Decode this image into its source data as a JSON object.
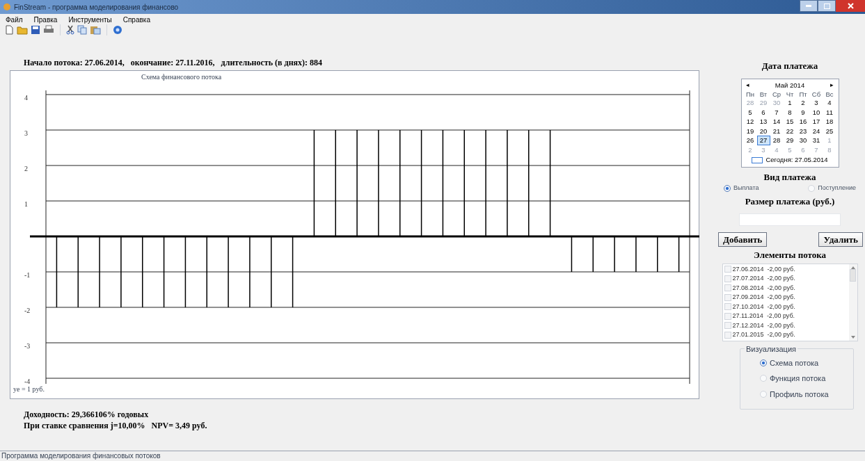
{
  "window": {
    "title": "FinStream - программа моделирования финансово"
  },
  "menu": [
    "Файл",
    "Правка",
    "Инструменты",
    "Справка"
  ],
  "toolbar": [
    {
      "kind": "new"
    },
    {
      "kind": "open"
    },
    {
      "kind": "save"
    },
    {
      "kind": "print"
    },
    {
      "kind": "sep"
    },
    {
      "kind": "cut"
    },
    {
      "kind": "copy"
    },
    {
      "kind": "paste"
    },
    {
      "kind": "sep"
    },
    {
      "kind": "help"
    }
  ],
  "summary": "Начало потока: 27.06.2014,   окончание: 27.11.2016,   длительность (в днях): 884",
  "chart": {
    "unit_label": "ye = 1 руб.",
    "chart_data": {
      "type": "bar",
      "grid": true,
      "title": "Схема финансового потока",
      "yticks": [
        -4,
        -3,
        -2,
        -1,
        1,
        2,
        3,
        4
      ],
      "ylim": [
        -4,
        4
      ],
      "values": [
        -2,
        -2,
        -2,
        -2,
        -2,
        -2,
        -2,
        -2,
        -2,
        -2,
        -2,
        -2,
        3,
        3,
        3,
        3,
        3,
        3,
        3,
        3,
        3,
        3,
        3,
        3,
        -1,
        -1,
        -1,
        -1,
        -1,
        -1
      ]
    }
  },
  "results": [
    "Доходность: 29,366106% годовых",
    "При ставке сравнения j=10,00%   NPV= 3,49 руб."
  ],
  "side": {
    "date_title": "Дата платежа",
    "calendar": {
      "month": "Май 2014",
      "prev": "◂",
      "next": "▸",
      "weekdays": [
        "Пн",
        "Вт",
        "Ср",
        "Чт",
        "Пт",
        "Сб",
        "Вс"
      ],
      "days": [
        {
          "day": "28",
          "other_month": true,
          "selected": false
        },
        {
          "day": "29",
          "other_month": true,
          "selected": false
        },
        {
          "day": "30",
          "other_month": true,
          "selected": false
        },
        {
          "day": "1",
          "other_month": false,
          "selected": false
        },
        {
          "day": "2",
          "other_month": false,
          "selected": false
        },
        {
          "day": "3",
          "other_month": false,
          "selected": false
        },
        {
          "day": "4",
          "other_month": false,
          "selected": false
        },
        {
          "day": "5",
          "other_month": false,
          "selected": false
        },
        {
          "day": "6",
          "other_month": false,
          "selected": false
        },
        {
          "day": "7",
          "other_month": false,
          "selected": false
        },
        {
          "day": "8",
          "other_month": false,
          "selected": false
        },
        {
          "day": "9",
          "other_month": false,
          "selected": false
        },
        {
          "day": "10",
          "other_month": false,
          "selected": false
        },
        {
          "day": "11",
          "other_month": false,
          "selected": false
        },
        {
          "day": "12",
          "other_month": false,
          "selected": false
        },
        {
          "day": "13",
          "other_month": false,
          "selected": false
        },
        {
          "day": "14",
          "other_month": false,
          "selected": false
        },
        {
          "day": "15",
          "other_month": false,
          "selected": false
        },
        {
          "day": "16",
          "other_month": false,
          "selected": false
        },
        {
          "day": "17",
          "other_month": false,
          "selected": false
        },
        {
          "day": "18",
          "other_month": false,
          "selected": false
        },
        {
          "day": "19",
          "other_month": false,
          "selected": false
        },
        {
          "day": "20",
          "other_month": false,
          "selected": false
        },
        {
          "day": "21",
          "other_month": false,
          "selected": false
        },
        {
          "day": "22",
          "other_month": false,
          "selected": false
        },
        {
          "day": "23",
          "other_month": false,
          "selected": false
        },
        {
          "day": "24",
          "other_month": false,
          "selected": false
        },
        {
          "day": "25",
          "other_month": false,
          "selected": false
        },
        {
          "day": "26",
          "other_month": false,
          "selected": false
        },
        {
          "day": "27",
          "other_month": false,
          "selected": true
        },
        {
          "day": "28",
          "other_month": false,
          "selected": false
        },
        {
          "day": "29",
          "other_month": false,
          "selected": false
        },
        {
          "day": "30",
          "other_month": false,
          "selected": false
        },
        {
          "day": "31",
          "other_month": false,
          "selected": false
        },
        {
          "day": "1",
          "other_month": true,
          "selected": false
        },
        {
          "day": "2",
          "other_month": true,
          "selected": false
        },
        {
          "day": "3",
          "other_month": true,
          "selected": false
        },
        {
          "day": "4",
          "other_month": true,
          "selected": false
        },
        {
          "day": "5",
          "other_month": true,
          "selected": false
        },
        {
          "day": "6",
          "other_month": true,
          "selected": false
        },
        {
          "day": "7",
          "other_month": true,
          "selected": false
        },
        {
          "day": "8",
          "other_month": true,
          "selected": false
        }
      ],
      "today": "Сегодня: 27.05.2014"
    },
    "type_title": "Вид платежа",
    "types": [
      {
        "label": "Выплата",
        "selected": true
      },
      {
        "label": "Поступление",
        "selected": false
      }
    ],
    "amount_title": "Размер платежа (руб.)",
    "buttons": [
      "Добавить",
      "Удалить"
    ],
    "elements_title": "Элементы потока",
    "elements": [
      {
        "label": "27.06.2014  -2,00 руб.",
        "checked": false
      },
      {
        "label": "27.07.2014  -2,00 руб.",
        "checked": false
      },
      {
        "label": "27.08.2014  -2,00 руб.",
        "checked": false
      },
      {
        "label": "27.09.2014  -2,00 руб.",
        "checked": false
      },
      {
        "label": "27.10.2014  -2,00 руб.",
        "checked": false
      },
      {
        "label": "27.11.2014  -2,00 руб.",
        "checked": false
      },
      {
        "label": "27.12.2014  -2,00 руб.",
        "checked": false
      },
      {
        "label": "27.01.2015  -2,00 руб.",
        "checked": false
      }
    ],
    "viz_title": "Визуализация",
    "viz": [
      {
        "label": "Схема потока",
        "selected": true
      },
      {
        "label": "Функция потока",
        "selected": false
      },
      {
        "label": "Профиль потока",
        "selected": false
      }
    ]
  },
  "status_bar": "Программа моделирования финансовых потоков"
}
